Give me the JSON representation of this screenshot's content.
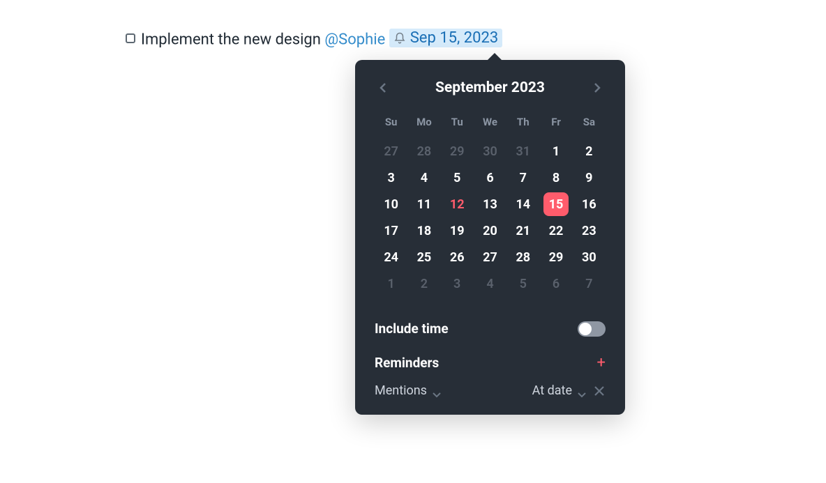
{
  "task": {
    "text": "Implement the new design",
    "mention": "@Sophie",
    "date": "Sep 15, 2023"
  },
  "calendar": {
    "title": "September 2023",
    "weekdays": [
      "Su",
      "Mo",
      "Tu",
      "We",
      "Th",
      "Fr",
      "Sa"
    ],
    "weeks": [
      [
        {
          "n": "27",
          "o": true
        },
        {
          "n": "28",
          "o": true
        },
        {
          "n": "29",
          "o": true
        },
        {
          "n": "30",
          "o": true
        },
        {
          "n": "31",
          "o": true
        },
        {
          "n": "1"
        },
        {
          "n": "2"
        }
      ],
      [
        {
          "n": "3"
        },
        {
          "n": "4"
        },
        {
          "n": "5"
        },
        {
          "n": "6"
        },
        {
          "n": "7"
        },
        {
          "n": "8"
        },
        {
          "n": "9"
        }
      ],
      [
        {
          "n": "10"
        },
        {
          "n": "11"
        },
        {
          "n": "12",
          "today": true
        },
        {
          "n": "13"
        },
        {
          "n": "14"
        },
        {
          "n": "15",
          "sel": true
        },
        {
          "n": "16"
        }
      ],
      [
        {
          "n": "17"
        },
        {
          "n": "18"
        },
        {
          "n": "19"
        },
        {
          "n": "20"
        },
        {
          "n": "21"
        },
        {
          "n": "22"
        },
        {
          "n": "23"
        }
      ],
      [
        {
          "n": "24"
        },
        {
          "n": "25"
        },
        {
          "n": "26"
        },
        {
          "n": "27"
        },
        {
          "n": "28"
        },
        {
          "n": "29"
        },
        {
          "n": "30"
        }
      ],
      [
        {
          "n": "1",
          "o": true
        },
        {
          "n": "2",
          "o": true
        },
        {
          "n": "3",
          "o": true
        },
        {
          "n": "4",
          "o": true
        },
        {
          "n": "5",
          "o": true
        },
        {
          "n": "6",
          "o": true
        },
        {
          "n": "7",
          "o": true
        }
      ]
    ]
  },
  "includeTime": {
    "label": "Include time",
    "on": false
  },
  "reminders": {
    "label": "Reminders",
    "items": [
      {
        "type": "Mentions",
        "when": "At date"
      }
    ]
  }
}
